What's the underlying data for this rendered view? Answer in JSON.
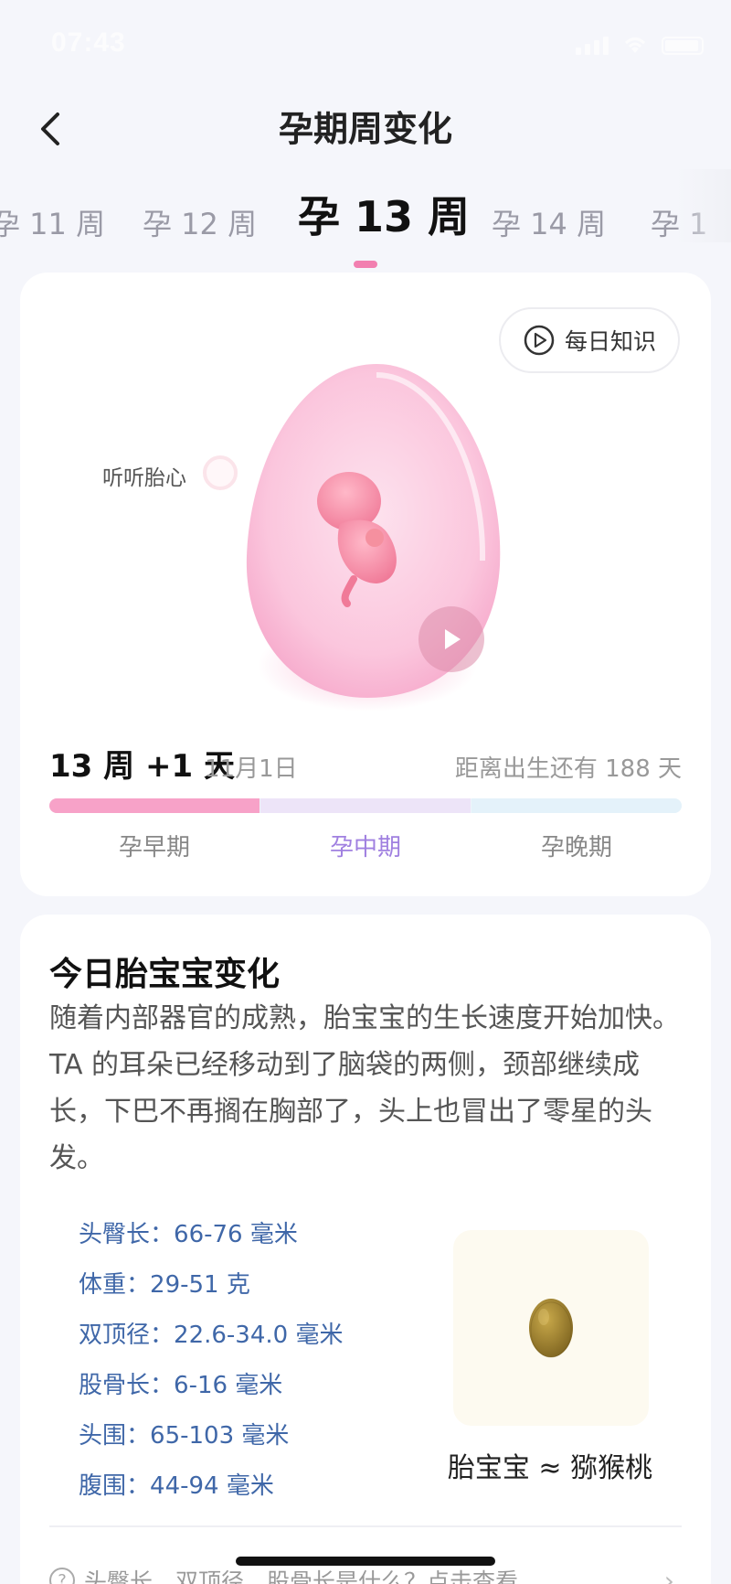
{
  "status_bar": {
    "time": "07:43"
  },
  "nav": {
    "title": "孕期周变化"
  },
  "weeks": [
    "孕 11 周",
    "孕 12 周",
    "孕 13 周",
    "孕 14 周",
    "孕 1"
  ],
  "current_week_index": 2,
  "card": {
    "knowledge_label": "每日知识",
    "heart_label": "听听胎心",
    "days_label": "13 周 +1 天",
    "date_label": "11月1日",
    "remaining_label": "距离出生还有 188 天",
    "progress": {
      "segments": [
        {
          "name": "孕早期",
          "fill": 1.0,
          "color": "#f7a2c8"
        },
        {
          "name": "孕中期",
          "fill": 1.0,
          "color": "#ede4f8"
        },
        {
          "name": "孕晚期",
          "fill": 1.0,
          "color": "#e4f2fa"
        }
      ],
      "current_marker": 0.335
    },
    "phases": [
      "孕早期",
      "孕中期",
      "孕晚期"
    ],
    "current_phase_index": 1
  },
  "changes": {
    "title": "今日胎宝宝变化",
    "description": "随着内部器官的成熟，胎宝宝的生长速度开始加快。TA 的耳朵已经移动到了脑袋的两侧，颈部继续成长，下巴不再搁在胸部了，头上也冒出了零星的头发。",
    "metrics": [
      {
        "label": "头臀长",
        "value": "66-76 毫米"
      },
      {
        "label": "体重",
        "value": "29-51 克"
      },
      {
        "label": "双顶径",
        "value": "22.6-34.0 毫米"
      },
      {
        "label": "股骨长",
        "value": "6-16 毫米"
      },
      {
        "label": "头围",
        "value": "65-103 毫米"
      },
      {
        "label": "腹围",
        "value": "44-94 毫米"
      }
    ],
    "fruit_caption": "胎宝宝 ≈ 猕猴桃",
    "faq": "头臀长、双顶径、股骨长是什么？点击查看"
  },
  "colors": {
    "accent_pink": "#f27fb0",
    "phase_current": "#a080e0",
    "metric_blue": "#3f67a8"
  },
  "icons": [
    "back-arrow-icon",
    "play-circle-icon",
    "heartbeat-dot-icon",
    "video-play-icon",
    "kiwi-fruit-image",
    "question-circle-icon",
    "chevron-right-icon"
  ]
}
